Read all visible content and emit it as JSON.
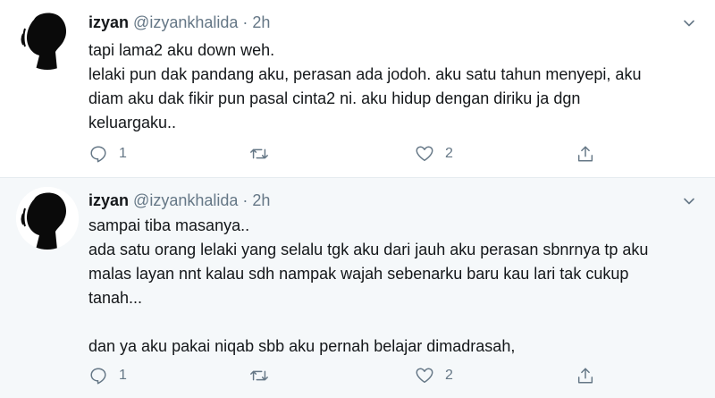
{
  "tweets": [
    {
      "name": "izyan",
      "handle": "@izyankhalida",
      "separator": "·",
      "time": "2h",
      "lines": [
        "tapi lama2 aku down weh.",
        "lelaki pun dak pandang aku, perasan ada jodoh. aku satu tahun menyepi,  aku",
        "diam aku dak fikir pun pasal cinta2 ni.  aku hidup dengan diriku ja dgn",
        "keluargaku.."
      ],
      "replies": "1",
      "likes": "2"
    },
    {
      "name": "izyan",
      "handle": "@izyankhalida",
      "separator": "·",
      "time": "2h",
      "lines": [
        "sampai tiba masanya..",
        "ada satu orang lelaki yang selalu tgk aku dari jauh aku perasan sbnrnya tp aku",
        "malas layan nnt kalau sdh nampak wajah sebenarku baru kau lari tak cukup",
        "tanah...",
        "",
        "dan ya aku pakai niqab sbb aku pernah belajar dimadrasah,"
      ],
      "replies": "1",
      "likes": "2"
    }
  ],
  "icons": {
    "reply": "reply-icon",
    "retweet": "retweet-icon",
    "like": "heart-icon",
    "share": "share-icon",
    "menu": "chevron-down-icon"
  },
  "colors": {
    "text": "#14171a",
    "muted": "#657786",
    "hover_bg": "#f5f8fa",
    "border": "#e6ecf0"
  }
}
